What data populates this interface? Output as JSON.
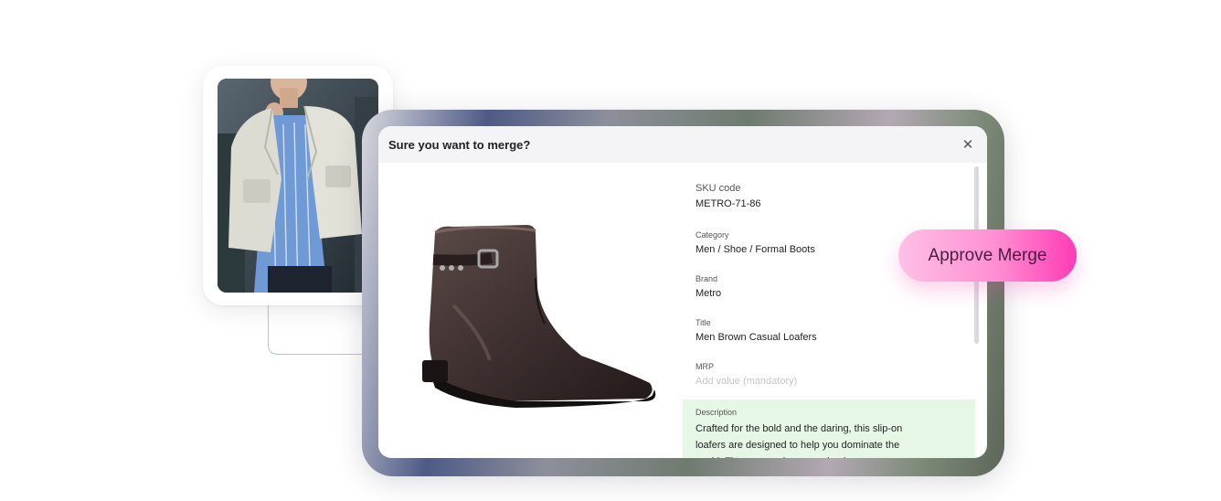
{
  "modal": {
    "title": "Sure you want to merge?",
    "close_icon": "close-icon"
  },
  "product": {
    "sku": {
      "label": "SKU code",
      "value": "METRO-71-86"
    },
    "category": {
      "label": "Category",
      "value": "Men / Shoe / Formal Boots"
    },
    "brand": {
      "label": "Brand",
      "value": "Metro"
    },
    "title": {
      "label": "Title",
      "value": "Men Brown Casual Loafers"
    },
    "mrp": {
      "label": "MRP",
      "placeholder": "Add value (mandatory)"
    },
    "description": {
      "label": "Description",
      "value": "Crafted for the bold and the daring, this slip-on loafers are designed to help you dominate the world. These men shoes exude elegance"
    }
  },
  "actions": {
    "approve_label": "Approve Merge"
  },
  "colors": {
    "accent_pink": "#ff3bb6",
    "description_highlight": "#e7f7e6",
    "header_bg": "#f4f3f6"
  }
}
